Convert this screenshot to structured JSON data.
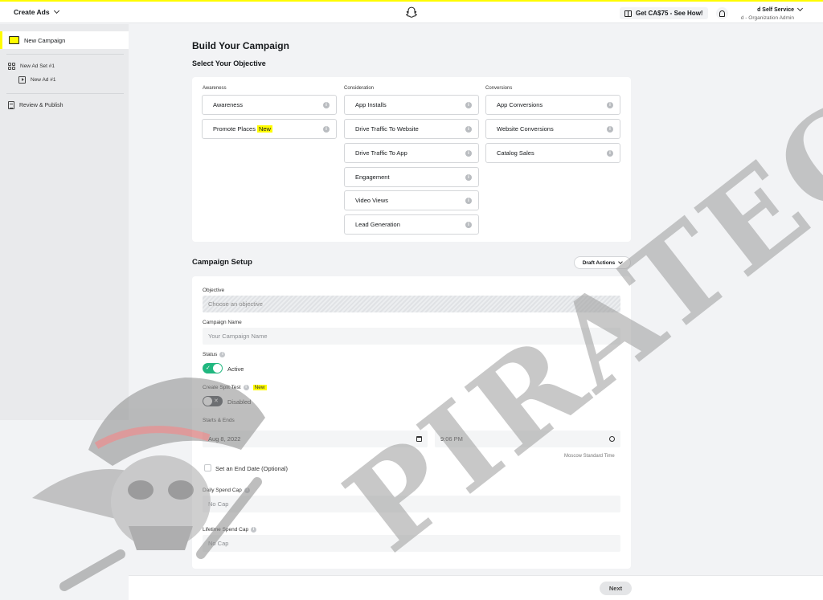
{
  "topbar": {
    "menu_label": "Create Ads",
    "promo_label": "Get CA$75 - See How!",
    "account_name": "d Self Service",
    "account_role": "d - Organization Admin"
  },
  "sidebar": {
    "campaign": "New Campaign",
    "ad_set": "New Ad Set #1",
    "ad": "New Ad #1",
    "review": "Review & Publish"
  },
  "main": {
    "title": "Build Your Campaign",
    "subtitle": "Select Your Objective",
    "columns": {
      "awareness": {
        "title": "Awareness",
        "items": [
          "Awareness",
          "Promote Places"
        ]
      },
      "consideration": {
        "title": "Consideration",
        "items": [
          "App Installs",
          "Drive Traffic To Website",
          "Drive Traffic To App",
          "Engagement",
          "Video Views",
          "Lead Generation"
        ]
      },
      "conversions": {
        "title": "Conversions",
        "items": [
          "App Conversions",
          "Website Conversions",
          "Catalog Sales"
        ]
      }
    },
    "new_badge": "New"
  },
  "setup": {
    "title": "Campaign Setup",
    "draft_actions": "Draft Actions",
    "objective_label": "Objective",
    "objective_placeholder": "Choose an objective",
    "name_label": "Campaign Name",
    "name_placeholder": "Your Campaign Name",
    "status_label": "Status",
    "status_value": "Active",
    "split_label": "Create Split Test",
    "split_badge": "New",
    "split_value": "Disabled",
    "dates_label": "Starts & Ends",
    "start_date": "Aug 8, 2022",
    "start_time": "9:06 PM",
    "timezone": "Moscow Standard Time",
    "end_date_label": "Set an End Date (Optional)",
    "daily_cap_label": "Daily Spend Cap",
    "daily_cap_placeholder": "No Cap",
    "lifetime_cap_label": "Lifetime Spend Cap",
    "lifetime_cap_placeholder": "No Cap"
  },
  "footer": {
    "next_label": "Next"
  },
  "watermark": {
    "text": "PIRATECPR"
  },
  "colors": {
    "brand_yellow": "#fffc00",
    "toggle_on": "#20b77f",
    "toggle_off": "#4a4e54",
    "watermark_gray": "#9a9a9a"
  }
}
